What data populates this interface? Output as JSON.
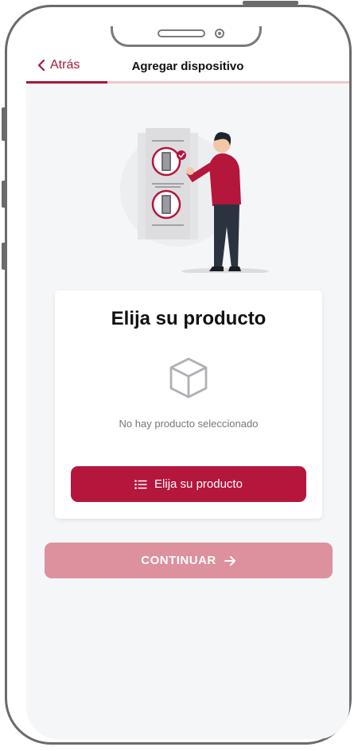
{
  "header": {
    "back_label": "Atrás",
    "title": "Agregar dispositivo",
    "progress_fraction": 0.25
  },
  "card": {
    "title": "Elija su producto",
    "empty_text": "No hay producto seleccionado",
    "choose_button_label": "Elija su producto"
  },
  "continue_button_label": "CONTINUAR",
  "icons": {
    "back": "chevron-left-icon",
    "empty": "box-icon",
    "choose": "list-icon",
    "continue": "arrow-right-icon"
  },
  "colors": {
    "accent": "#b5163c",
    "accent_disabled": "#dd909e",
    "background": "#f5f6f8"
  }
}
